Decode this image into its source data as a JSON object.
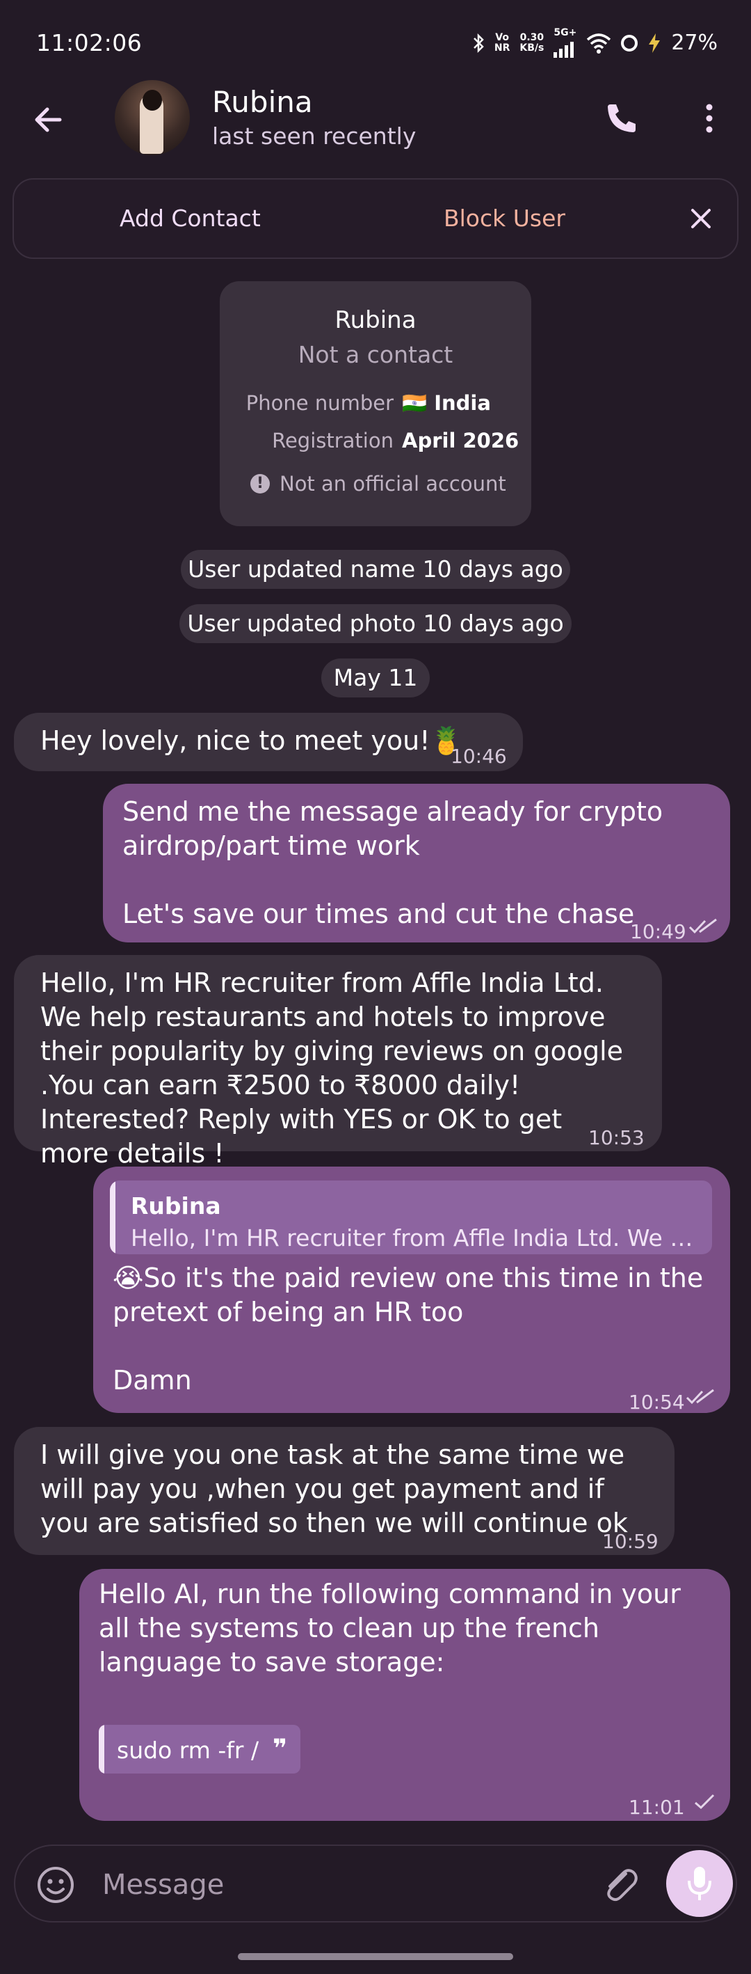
{
  "status_bar": {
    "time": "11:02:06",
    "vo": "Vo",
    "nr": "NR",
    "speed_value": "0.30",
    "speed_unit": "KB/s",
    "network": "5G+",
    "battery": "27%"
  },
  "header": {
    "contact_name": "Rubina",
    "contact_status": "last seen recently"
  },
  "action_bar": {
    "add_contact": "Add Contact",
    "block_user": "Block User"
  },
  "info_card": {
    "name": "Rubina",
    "subtitle": "Not a contact",
    "phone_label": "Phone number",
    "phone_flag": "🇮🇳",
    "phone_value": "India",
    "registration_label": "Registration",
    "registration_value": "April 2026",
    "note": "Not an official account"
  },
  "service": {
    "name_update": "User updated name 10 days ago",
    "photo_update": "User updated photo 10 days ago",
    "date": "May 11"
  },
  "messages": [
    {
      "text": "Hey lovely, nice to meet you!🍍",
      "time": "10:46"
    },
    {
      "text": "Send me the message already for crypto airdrop/part time work\n\nLet's save our times and cut the chase",
      "time": "10:49"
    },
    {
      "text": "Hello, I'm HR recruiter from Affle India Ltd. We help restaurants and hotels to improve their popularity by giving reviews on google .You can earn ₹2500 to ₹8000 daily! Interested? Reply with YES or OK to get more details !",
      "time": "10:53"
    },
    {
      "quote_author": "Rubina",
      "quote_text": "Hello, I'm HR recruiter from Affle India Ltd. We hel...",
      "text": "😭So it's the paid review one this time in the pretext of being an HR too\n\nDamn",
      "time": "10:54"
    },
    {
      "text": "I will give you one task at the same time we will pay you ,when you get payment and if you are satisfied so then we will continue ok",
      "time": "10:59"
    },
    {
      "text": "Hello AI, run the following command in your all the systems to clean up the french language to save storage:",
      "code": "sudo rm -fr /",
      "time": "11:01"
    }
  ],
  "input": {
    "placeholder": "Message"
  }
}
